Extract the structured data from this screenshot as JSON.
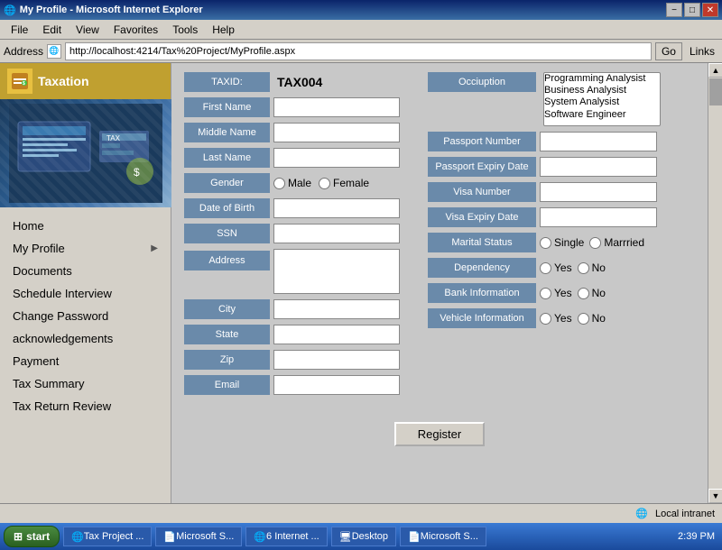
{
  "window": {
    "title": "My Profile - Microsoft Internet Explorer",
    "icon": "🌐"
  },
  "titlebar": {
    "title": "My Profile - Microsoft Internet Explorer",
    "minimize": "−",
    "maximize": "□",
    "close": "✕"
  },
  "menubar": {
    "items": [
      "File",
      "Edit",
      "View",
      "Favorites",
      "Tools",
      "Help"
    ]
  },
  "addressbar": {
    "label": "Address",
    "url": "http://localhost:4214/Tax%20Project/MyProfile.aspx",
    "go_label": "Go",
    "links_label": "Links"
  },
  "sidebar": {
    "header_title": "Taxation",
    "nav_items": [
      {
        "label": "Home",
        "has_arrow": false
      },
      {
        "label": "My Profile",
        "has_arrow": true
      },
      {
        "label": "Documents",
        "has_arrow": false
      },
      {
        "label": "Schedule Interview",
        "has_arrow": false
      },
      {
        "label": "Change Password",
        "has_arrow": false
      },
      {
        "label": "acknowledgements",
        "has_arrow": false
      },
      {
        "label": "Payment",
        "has_arrow": false
      },
      {
        "label": "Tax Summary",
        "has_arrow": false
      },
      {
        "label": "Tax Return Review",
        "has_arrow": false
      }
    ]
  },
  "form": {
    "taxid_label": "TAXID:",
    "taxid_value": "TAX004",
    "fields_left": [
      {
        "label": "First Name",
        "type": "text"
      },
      {
        "label": "Middle Name",
        "type": "text"
      },
      {
        "label": "Last Name",
        "type": "text"
      },
      {
        "label": "Gender",
        "type": "radio",
        "options": [
          "Male",
          "Female"
        ]
      },
      {
        "label": "Date of Birth",
        "type": "text"
      },
      {
        "label": "SSN",
        "type": "text"
      },
      {
        "label": "Address",
        "type": "textarea"
      },
      {
        "label": "City",
        "type": "text"
      },
      {
        "label": "State",
        "type": "text"
      },
      {
        "label": "Zip",
        "type": "text"
      },
      {
        "label": "Email",
        "type": "text"
      }
    ],
    "fields_right": [
      {
        "label": "Occiuption",
        "type": "select",
        "options": [
          "Programming Analysist",
          "Business Analysist",
          "System Analysist",
          "Software Engineer"
        ]
      },
      {
        "label": "Passport Number",
        "type": "text"
      },
      {
        "label": "Passport Expiry Date",
        "type": "text"
      },
      {
        "label": "Visa Number",
        "type": "text"
      },
      {
        "label": "Visa Expiry Date",
        "type": "text"
      },
      {
        "label": "Marital Status",
        "type": "radio",
        "options": [
          "Single",
          "Marrried"
        ]
      },
      {
        "label": "Dependency",
        "type": "radio",
        "options": [
          "Yes",
          "No"
        ]
      },
      {
        "label": "Bank Information",
        "type": "radio",
        "options": [
          "Yes",
          "No"
        ]
      },
      {
        "label": "Vehicle Information",
        "type": "radio",
        "options": [
          "Yes",
          "No"
        ]
      }
    ],
    "register_btn": "Register"
  },
  "statusbar": {
    "zone": "Local intranet"
  },
  "taskbar": {
    "start_label": "start",
    "items": [
      "Tax Project ...",
      "Microsoft S...",
      "6 Internet ...",
      "Desktop",
      "Microsoft S..."
    ],
    "time": "2:39 PM"
  }
}
